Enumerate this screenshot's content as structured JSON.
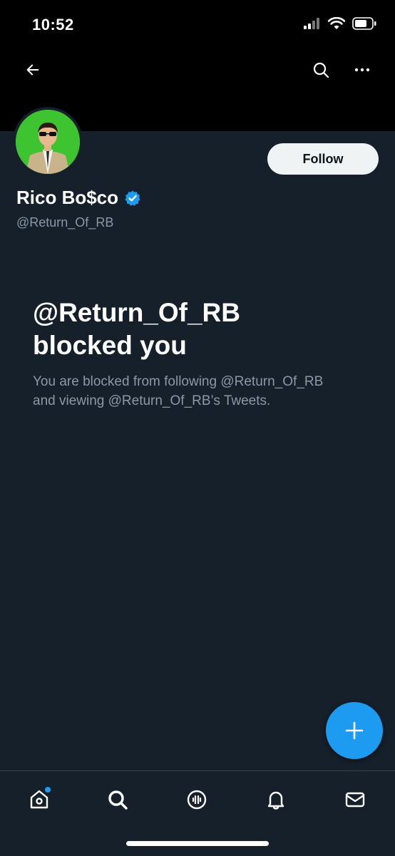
{
  "status_bar": {
    "time": "10:52"
  },
  "header": {
    "back_icon": "arrow-left-icon",
    "search_icon": "search-icon",
    "more_icon": "more-horizontal-icon"
  },
  "profile": {
    "display_name": "Rico Bo$co",
    "verified": true,
    "handle": "@Return_Of_RB",
    "follow_label": "Follow"
  },
  "blocked": {
    "title_line1": "@Return_Of_RB",
    "title_line2": "blocked you",
    "desc_line1": "You are blocked from following @Return_Of_RB",
    "desc_line2": "and viewing @Return_Of_RB’s Tweets."
  },
  "fab": {
    "icon": "plus-icon"
  },
  "tabbar": {
    "items": [
      {
        "icon": "home-icon",
        "has_notification_dot": true
      },
      {
        "icon": "search-icon",
        "active": true
      },
      {
        "icon": "spaces-icon"
      },
      {
        "icon": "bell-icon"
      },
      {
        "icon": "mail-icon"
      }
    ]
  },
  "colors": {
    "accent": "#1d9bf0",
    "background": "#15202b",
    "secondary_text": "#8b98a5"
  }
}
